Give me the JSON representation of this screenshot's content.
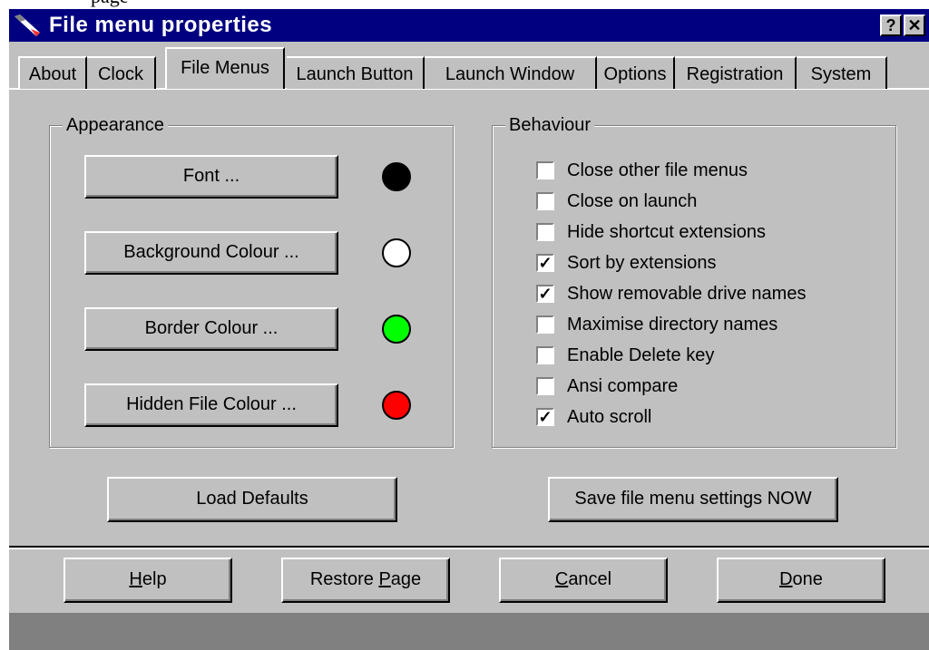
{
  "top_fragment": "page",
  "window": {
    "title": "File menu properties",
    "help_btn": "?",
    "close_btn": "✕"
  },
  "tabs": [
    {
      "label": "About"
    },
    {
      "label": "Clock"
    },
    {
      "label": "File Menus",
      "active": true
    },
    {
      "label": "Launch Button"
    },
    {
      "label": "Launch Window"
    },
    {
      "label": "Options"
    },
    {
      "label": "Registration"
    },
    {
      "label": "System"
    }
  ],
  "appearance": {
    "legend": "Appearance",
    "buttons": [
      {
        "label": "Font ...",
        "color": "#000000"
      },
      {
        "label": "Background Colour ...",
        "color": "#ffffff"
      },
      {
        "label": "Border Colour ...",
        "color": "#00ff00"
      },
      {
        "label": "Hidden File Colour ...",
        "color": "#ff0000"
      }
    ]
  },
  "behaviour": {
    "legend": "Behaviour",
    "options": [
      {
        "label": "Close other file menus",
        "checked": false
      },
      {
        "label": "Close on launch",
        "checked": false
      },
      {
        "label": "Hide shortcut extensions",
        "checked": false
      },
      {
        "label": "Sort by extensions",
        "checked": true
      },
      {
        "label": "Show removable drive names",
        "checked": true
      },
      {
        "label": "Maximise directory names",
        "checked": false
      },
      {
        "label": "Enable Delete key",
        "checked": false
      },
      {
        "label": "Ansi compare",
        "checked": false
      },
      {
        "label": "Auto scroll",
        "checked": true
      }
    ]
  },
  "actions": {
    "load_defaults": "Load Defaults",
    "save_now": "Save file menu settings NOW"
  },
  "footer": {
    "help": {
      "pre": "",
      "key": "H",
      "post": "elp"
    },
    "restore": {
      "pre": "Restore ",
      "key": "P",
      "post": "age"
    },
    "cancel": {
      "pre": "",
      "key": "C",
      "post": "ancel"
    },
    "done": {
      "pre": "",
      "key": "D",
      "post": "one"
    }
  }
}
